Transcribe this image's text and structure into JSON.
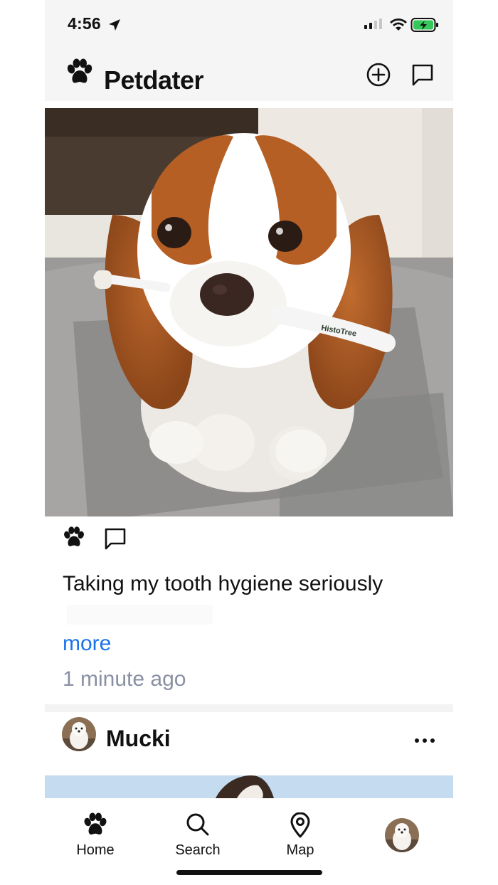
{
  "status_bar": {
    "time": "4:56"
  },
  "app": {
    "title": "Petdater"
  },
  "post": {
    "caption": "Taking my tooth hygiene seriously",
    "more_label": "more",
    "timestamp": "1 minute ago",
    "image_text": "HistoTree"
  },
  "next_post": {
    "author": "Mucki"
  },
  "tabs": [
    {
      "label": "Home",
      "icon": "paw-icon"
    },
    {
      "label": "Search",
      "icon": "search-icon"
    },
    {
      "label": "Map",
      "icon": "map-pin-icon"
    },
    {
      "label": "",
      "icon": "profile-avatar"
    }
  ],
  "colors": {
    "accent": "#1a73e8",
    "muted": "#8a90a3",
    "battery": "#34c759"
  }
}
